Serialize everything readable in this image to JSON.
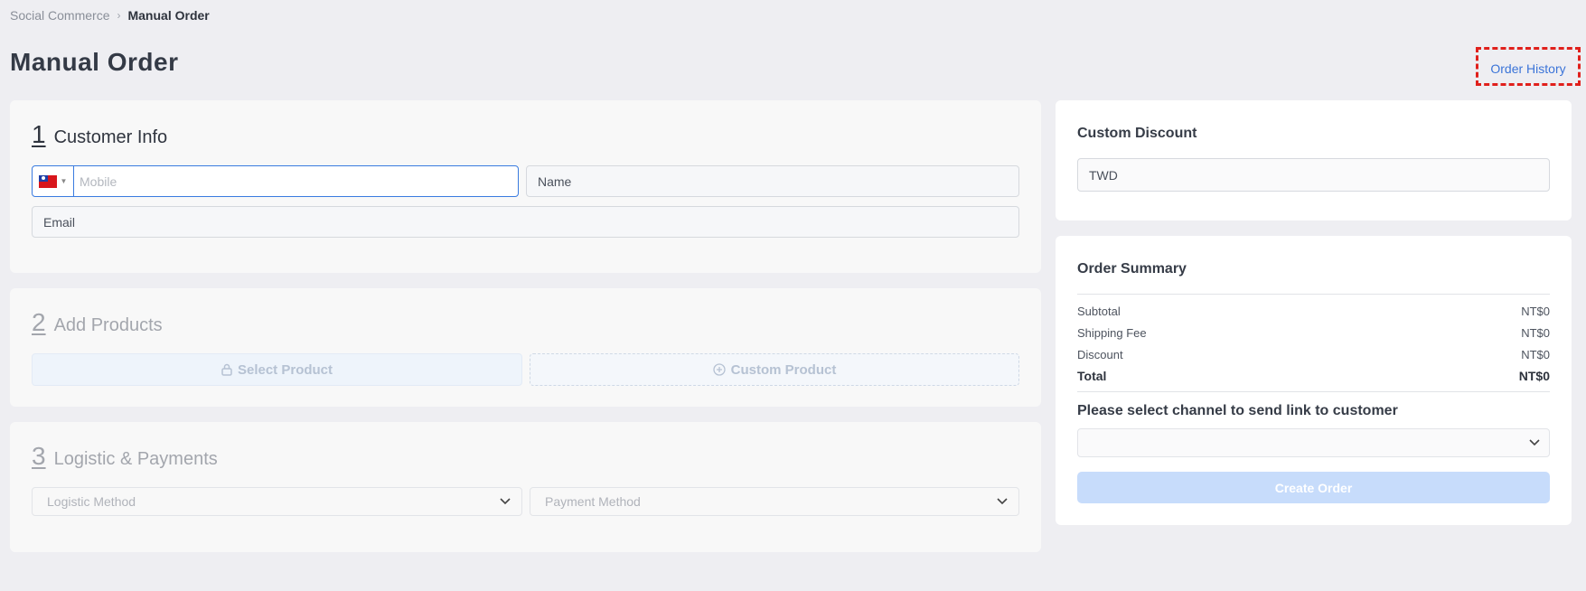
{
  "breadcrumb": {
    "parent": "Social Commerce",
    "separator": "›",
    "current": "Manual Order"
  },
  "page": {
    "title": "Manual Order",
    "history_button": "Order History"
  },
  "customer_info": {
    "step_number": "1",
    "step_label": "Customer Info",
    "mobile_placeholder": "Mobile",
    "country": "Taiwan",
    "name_placeholder": "Name",
    "email_placeholder": "Email"
  },
  "add_products": {
    "step_number": "2",
    "step_label": "Add Products",
    "select_product": "Select Product",
    "custom_product": "Custom Product"
  },
  "logistics": {
    "step_number": "3",
    "step_label": "Logistic & Payments",
    "logistic_placeholder": "Logistic Method",
    "payment_placeholder": "Payment Method"
  },
  "custom_discount": {
    "title": "Custom Discount",
    "currency_placeholder": "TWD"
  },
  "order_summary": {
    "title": "Order Summary",
    "rows": [
      {
        "label": "Subtotal",
        "value": "NT$0"
      },
      {
        "label": "Shipping Fee",
        "value": "NT$0"
      },
      {
        "label": "Discount",
        "value": "NT$0"
      }
    ],
    "total": {
      "label": "Total",
      "value": "NT$0"
    },
    "channel_prompt": "Please select channel to send link to customer",
    "channel_value": "",
    "create_button": "Create Order"
  },
  "colors": {
    "accent": "#3b74d8",
    "highlight": "#e0201c",
    "disabled_button": "#c7dcfb"
  }
}
